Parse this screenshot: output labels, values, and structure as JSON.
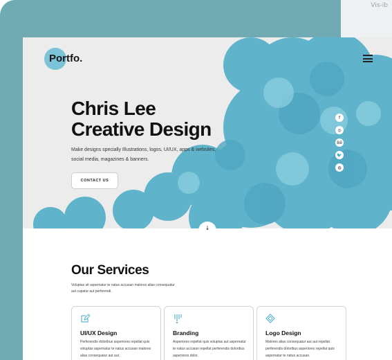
{
  "background": {
    "frame_color": "#70aab3",
    "behind_window_text": "Vis-ib"
  },
  "nav": {
    "logo": "Portfo.",
    "logo_color": "#7cc3d8",
    "menu_icon": "hamburger-menu-icon"
  },
  "hero": {
    "title_line1": "Chris Lee",
    "title_line2": "Creative Design",
    "description": "Make designs specially Illustrations, logos, UI/UX, apps & websites, social media, magazines & banners.",
    "button_label": "CONTACT US",
    "art_color": "#5fb4cc",
    "socials": [
      {
        "icon": "facebook-icon",
        "glyph": "f"
      },
      {
        "icon": "instagram-icon",
        "glyph": "◎"
      },
      {
        "icon": "behance-icon",
        "glyph": "Bē"
      },
      {
        "icon": "twitter-icon",
        "glyph": "🐦"
      },
      {
        "icon": "dribbble-icon",
        "glyph": "◍"
      }
    ],
    "scroll_glyph": "↓"
  },
  "services": {
    "title": "Our Services",
    "description": "Voluptas sit aspernatur te natus accusan malores alias consequatur aut cupatur aut perferendi.",
    "cards": [
      {
        "icon": "edit-icon",
        "title": "UI/UX Design",
        "description": "Perferendis doloribus asperiores repellat quis voluptas aspernatur te natus accusan malores alias consequatur aut aut."
      },
      {
        "icon": "brush-icon",
        "title": "Branding",
        "description": "Asperiores repellat quis voluptas aut aspernatur te natus accusan repellat perferendis doloribus asperiores dolor."
      },
      {
        "icon": "diamond-icon",
        "title": "Logo Design",
        "description": "Malores alias consequatur aut aut repellat perferendis doloribus asperiores repellat quis aspernatur te natus accusan."
      }
    ]
  }
}
